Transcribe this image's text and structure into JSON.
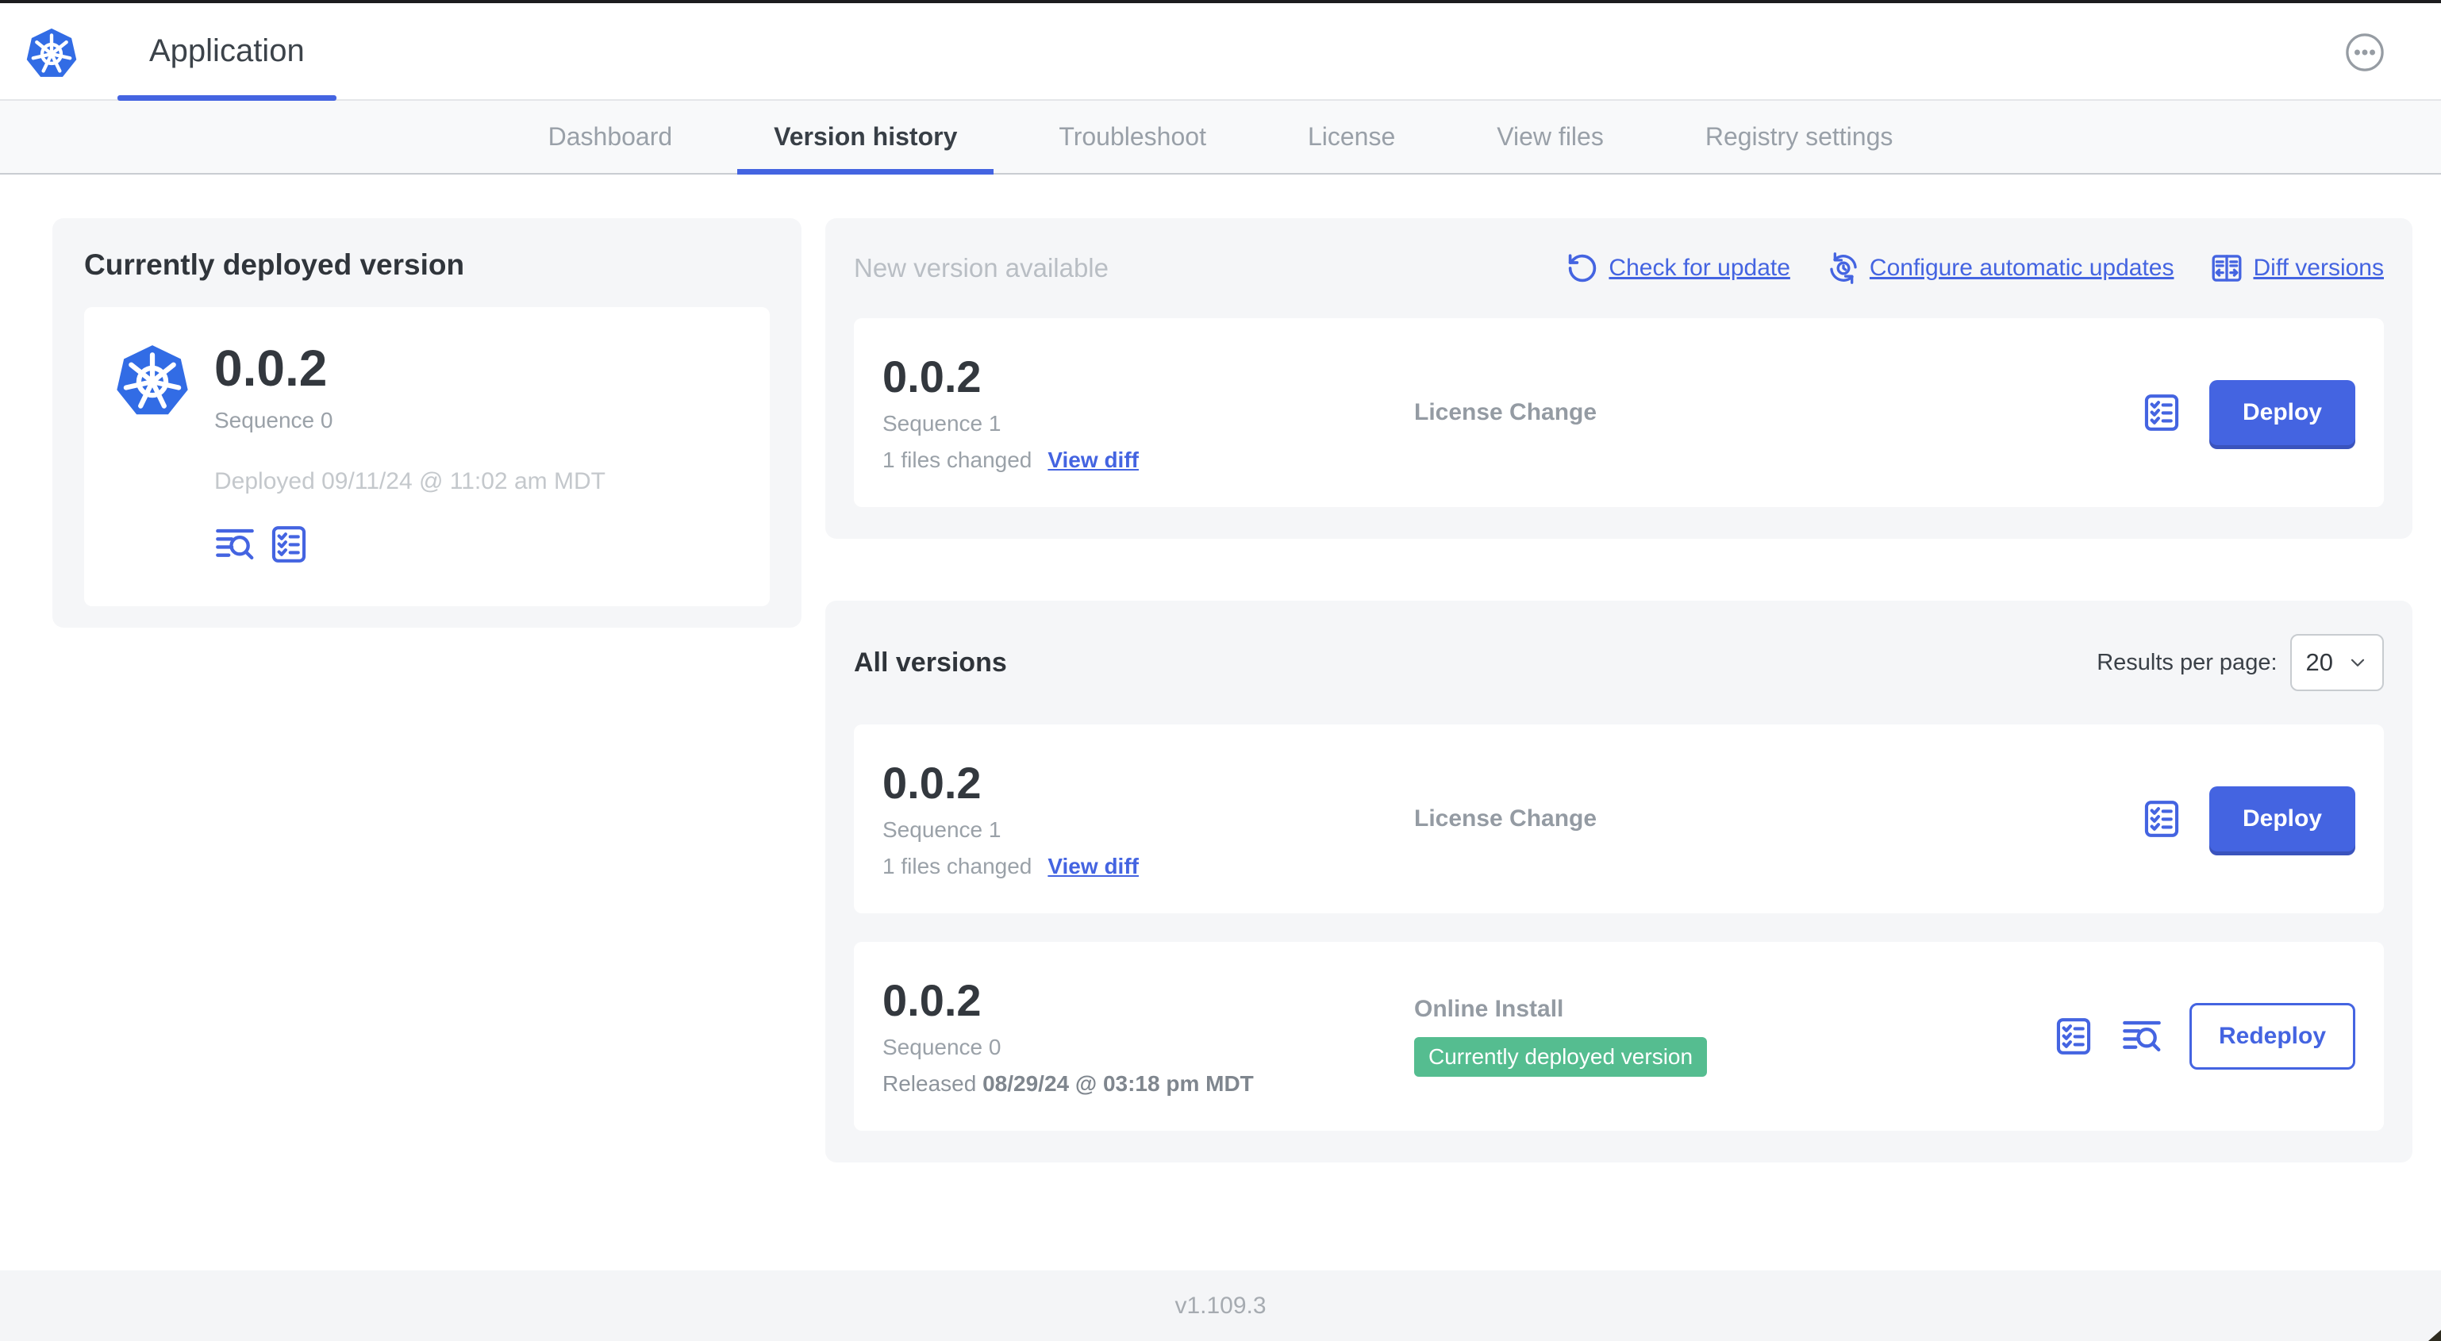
{
  "colors": {
    "accent": "#4464e1",
    "accent_dark": "#3a53bd",
    "green": "#55bd90",
    "k8s_blue": "#326ce5"
  },
  "header": {
    "app_title": "Application"
  },
  "nav": {
    "tabs": [
      {
        "label": "Dashboard",
        "active": false
      },
      {
        "label": "Version history",
        "active": true
      },
      {
        "label": "Troubleshoot",
        "active": false
      },
      {
        "label": "License",
        "active": false
      },
      {
        "label": "View files",
        "active": false
      },
      {
        "label": "Registry settings",
        "active": false
      }
    ]
  },
  "current_version_card": {
    "title": "Currently deployed version",
    "version": "0.0.2",
    "sequence": "Sequence 0",
    "deployed_at": "Deployed 09/11/24 @ 11:02 am MDT"
  },
  "new_version_section": {
    "title": "New version available",
    "check_for_update": "Check for update",
    "configure_updates": "Configure automatic updates",
    "diff_versions": "Diff versions",
    "row": {
      "version": "0.0.2",
      "sequence": "Sequence 1",
      "files_changed": "1 files changed",
      "view_diff": "View diff",
      "source": "License Change",
      "deploy_label": "Deploy"
    }
  },
  "all_versions_section": {
    "title": "All versions",
    "results_per_page_label": "Results per page:",
    "results_per_page_value": "20",
    "rows": [
      {
        "version": "0.0.2",
        "sequence": "Sequence 1",
        "files_changed": "1 files changed",
        "view_diff": "View diff",
        "source": "License Change",
        "action_label": "Deploy"
      },
      {
        "version": "0.0.2",
        "sequence": "Sequence 0",
        "released_prefix": "Released ",
        "released_date": "08/29/24 @ 03:18 pm MDT",
        "source": "Online Install",
        "badge": "Currently deployed version",
        "action_label": "Redeploy"
      }
    ]
  },
  "footer": {
    "app_version": "v1.109.3"
  }
}
